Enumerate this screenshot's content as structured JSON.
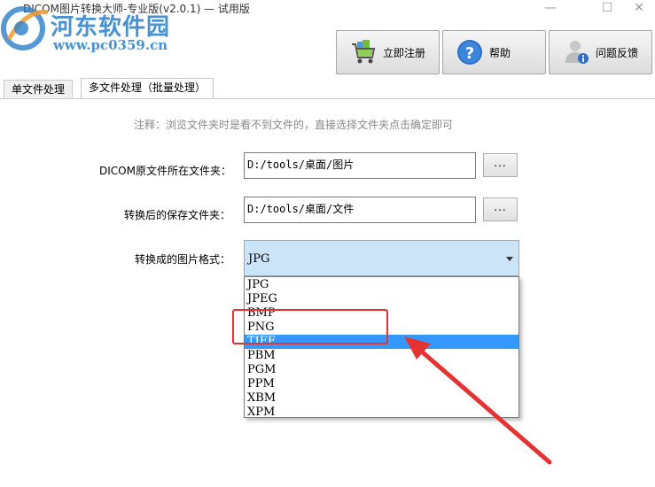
{
  "window": {
    "title": "DICOM图片转换大师-专业版(v2.0.1) — 试用版",
    "minimize_glyph": "—",
    "maximize_glyph": "☐",
    "close_glyph": "✕"
  },
  "watermark": {
    "site_name": "河东软件园",
    "url": "www.pc0359.cn"
  },
  "toolbar": {
    "register_label": "立即注册",
    "help_label": "帮助",
    "feedback_label": "问题反馈"
  },
  "tabs": [
    {
      "label": "单文件处理",
      "active": false
    },
    {
      "label": "多文件处理（批量处理）",
      "active": true
    }
  ],
  "batch": {
    "note": "注释：浏览文件夹时是看不到文件的，直接选择文件夹点击确定即可",
    "source_label": "DICOM原文件所在文件夹：",
    "source_value": "D:/tools/桌面/图片",
    "browse_label": "...",
    "dest_label": "转换后的保存文件夹：",
    "dest_value": "D:/tools/桌面/文件",
    "format_label": "转换成的图片格式：",
    "format_selected": "JPG",
    "format_options": [
      "JPG",
      "JPEG",
      "BMP",
      "PNG",
      "TIFF",
      "PBM",
      "PGM",
      "PPM",
      "XBM",
      "XPM"
    ],
    "highlighted_option": "TIFF"
  },
  "colors": {
    "accent": "#3399ff",
    "annotation_red": "#e53333",
    "select_bg": "#cce4f7",
    "watermark_blue": "#2a7fc9"
  },
  "icons": {
    "register": "shopping-cart-icon",
    "help": "question-icon",
    "feedback": "user-feedback-icon"
  }
}
